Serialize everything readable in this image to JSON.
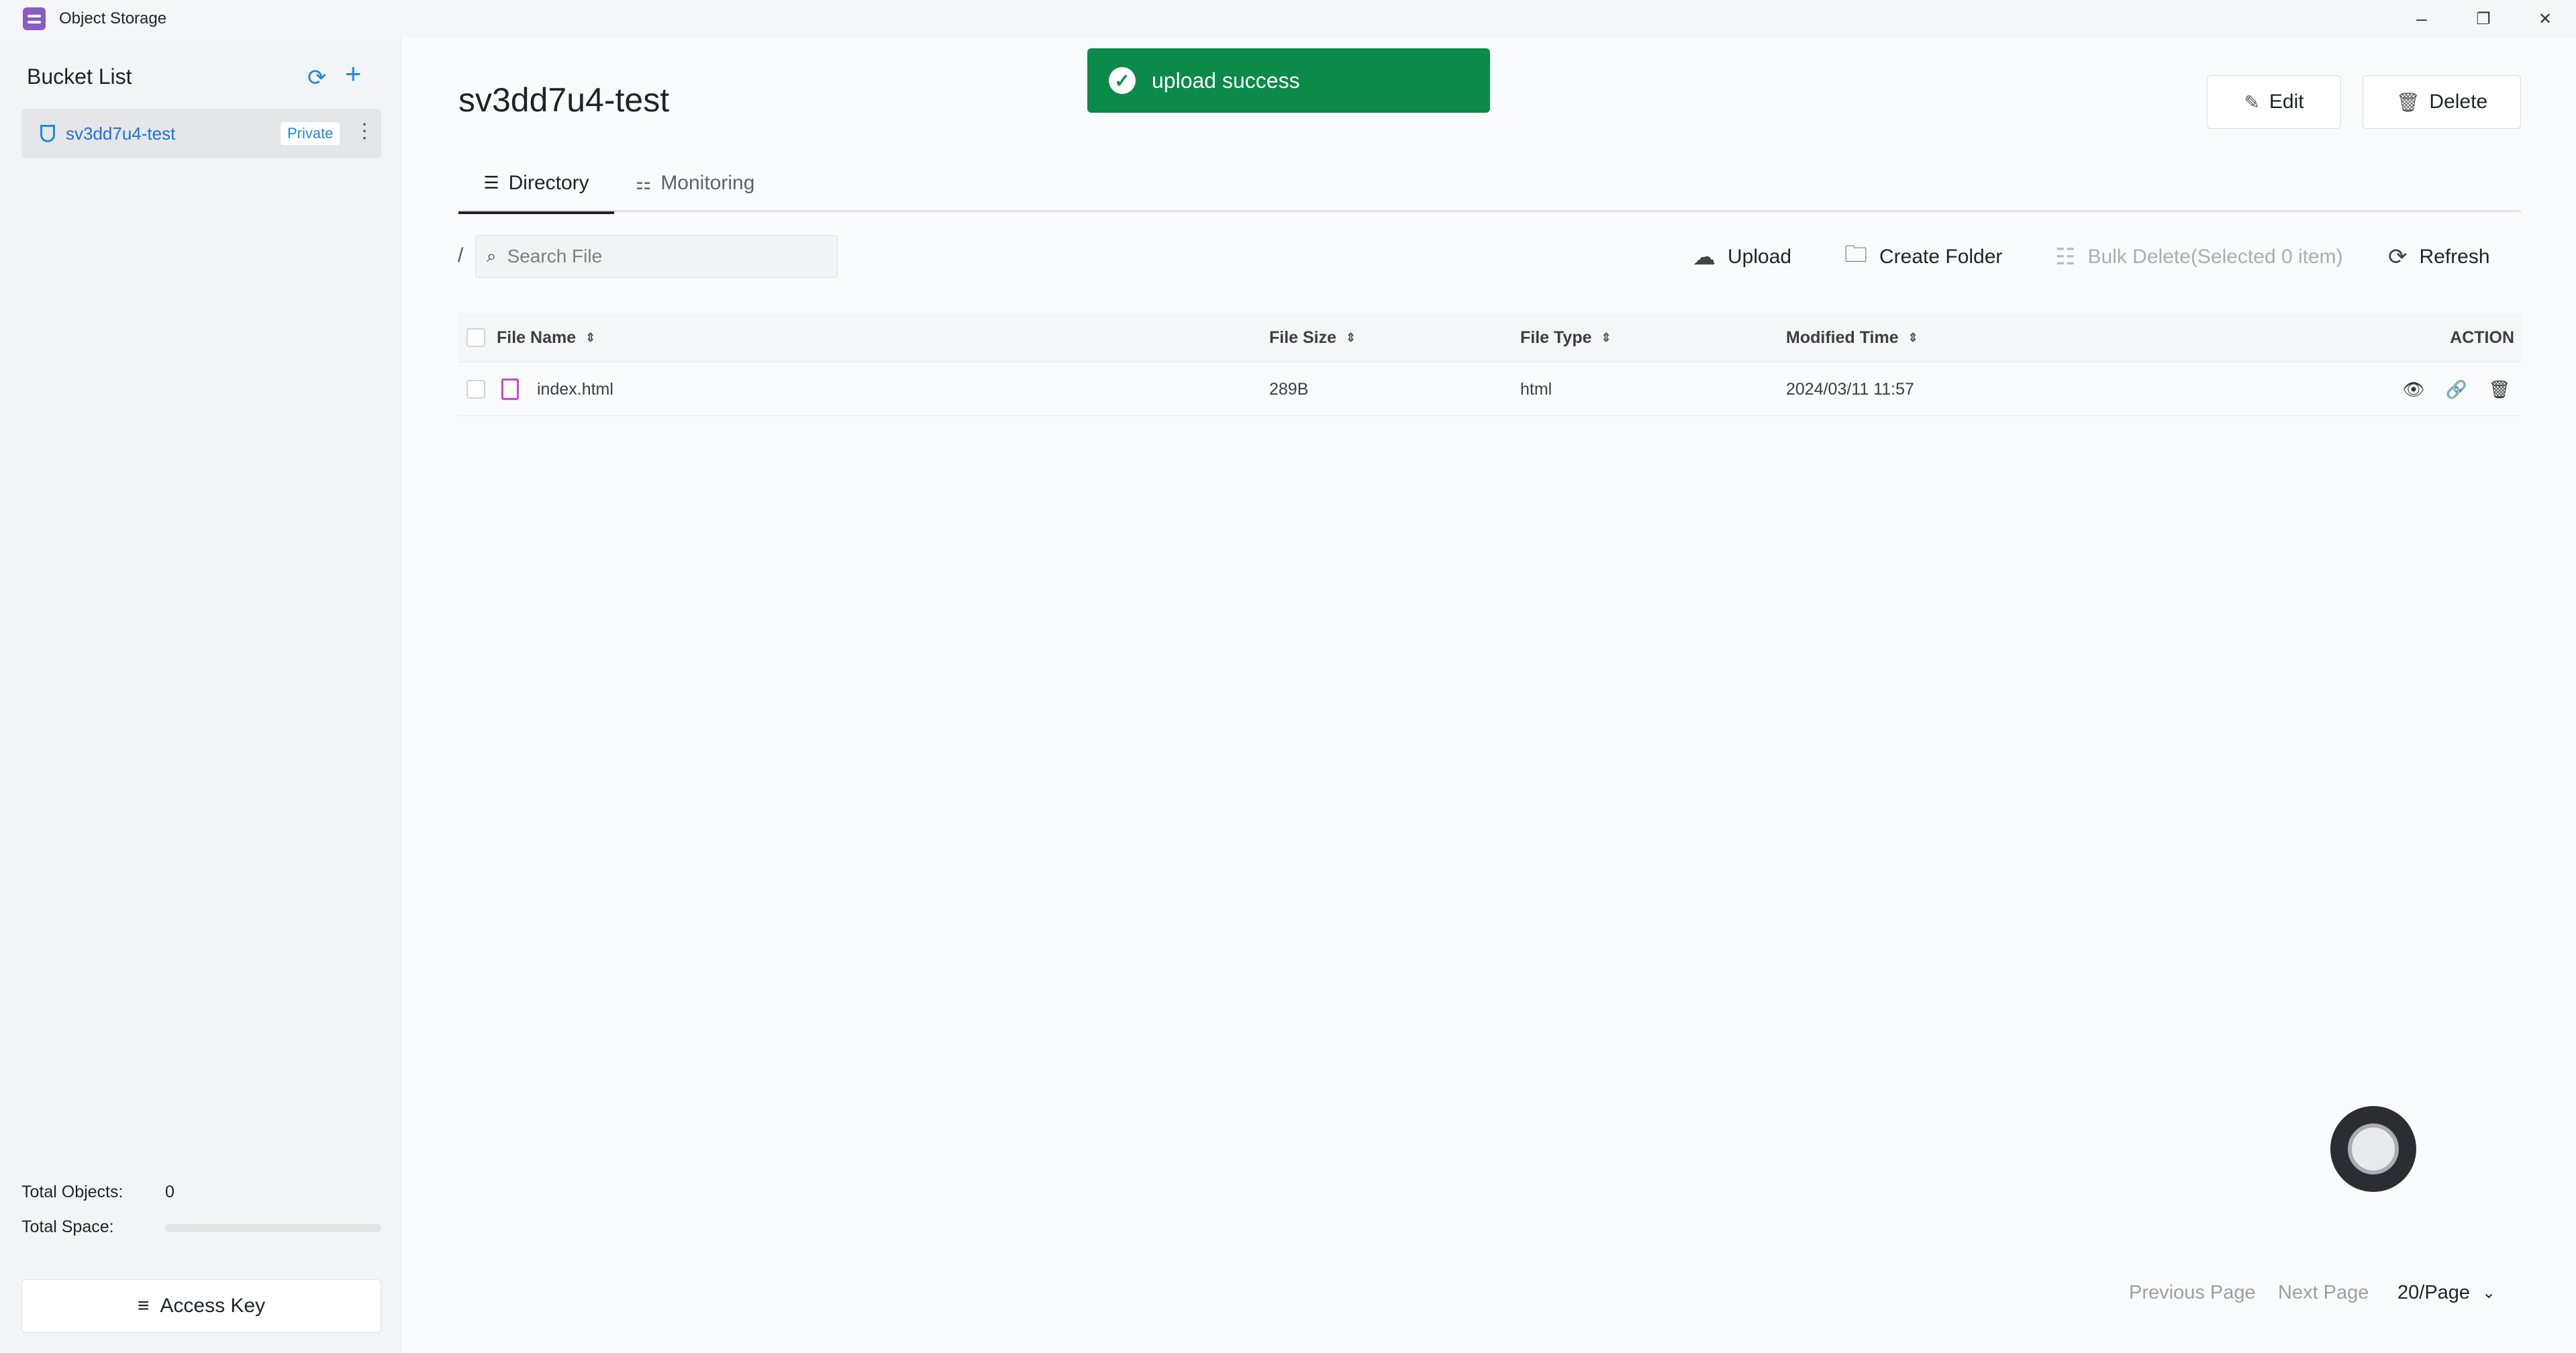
{
  "window": {
    "title": "Object Storage",
    "controls": {
      "minimize": "–",
      "restore": "❐",
      "close": "✕"
    }
  },
  "sidebar": {
    "heading": "Bucket List",
    "buckets": [
      {
        "name": "sv3dd7u4-test",
        "badge": "Private"
      }
    ],
    "stats": {
      "total_objects_label": "Total Objects:",
      "total_objects_value": "0",
      "total_space_label": "Total Space:",
      "total_space_fraction": 0
    },
    "access_key_label": "Access Key"
  },
  "main": {
    "title": "sv3dd7u4-test",
    "edit_label": "Edit",
    "delete_label": "Delete",
    "toast": "upload success",
    "tabs": [
      {
        "label": "Directory",
        "active": true
      },
      {
        "label": "Monitoring",
        "active": false
      }
    ],
    "breadcrumb": "/",
    "search_placeholder": "Search File",
    "actions": {
      "upload": "Upload",
      "create_folder": "Create Folder",
      "bulk_delete": "Bulk Delete(Selected 0 item)",
      "refresh": "Refresh"
    },
    "table": {
      "columns": [
        "File Name",
        "File Size",
        "File Type",
        "Modified Time",
        "ACTION"
      ],
      "rows": [
        {
          "name": "index.html",
          "size": "289B",
          "type": "html",
          "modified": "2024/03/11 11:57"
        }
      ]
    },
    "pager": {
      "prev": "Previous Page",
      "next": "Next Page",
      "page_size": "20/Page"
    }
  },
  "colors": {
    "accent": "#1e88e5",
    "toast_bg": "#0b8a4a",
    "app_icon": "#8b5cc4",
    "file_icon": "#c84bc5"
  }
}
